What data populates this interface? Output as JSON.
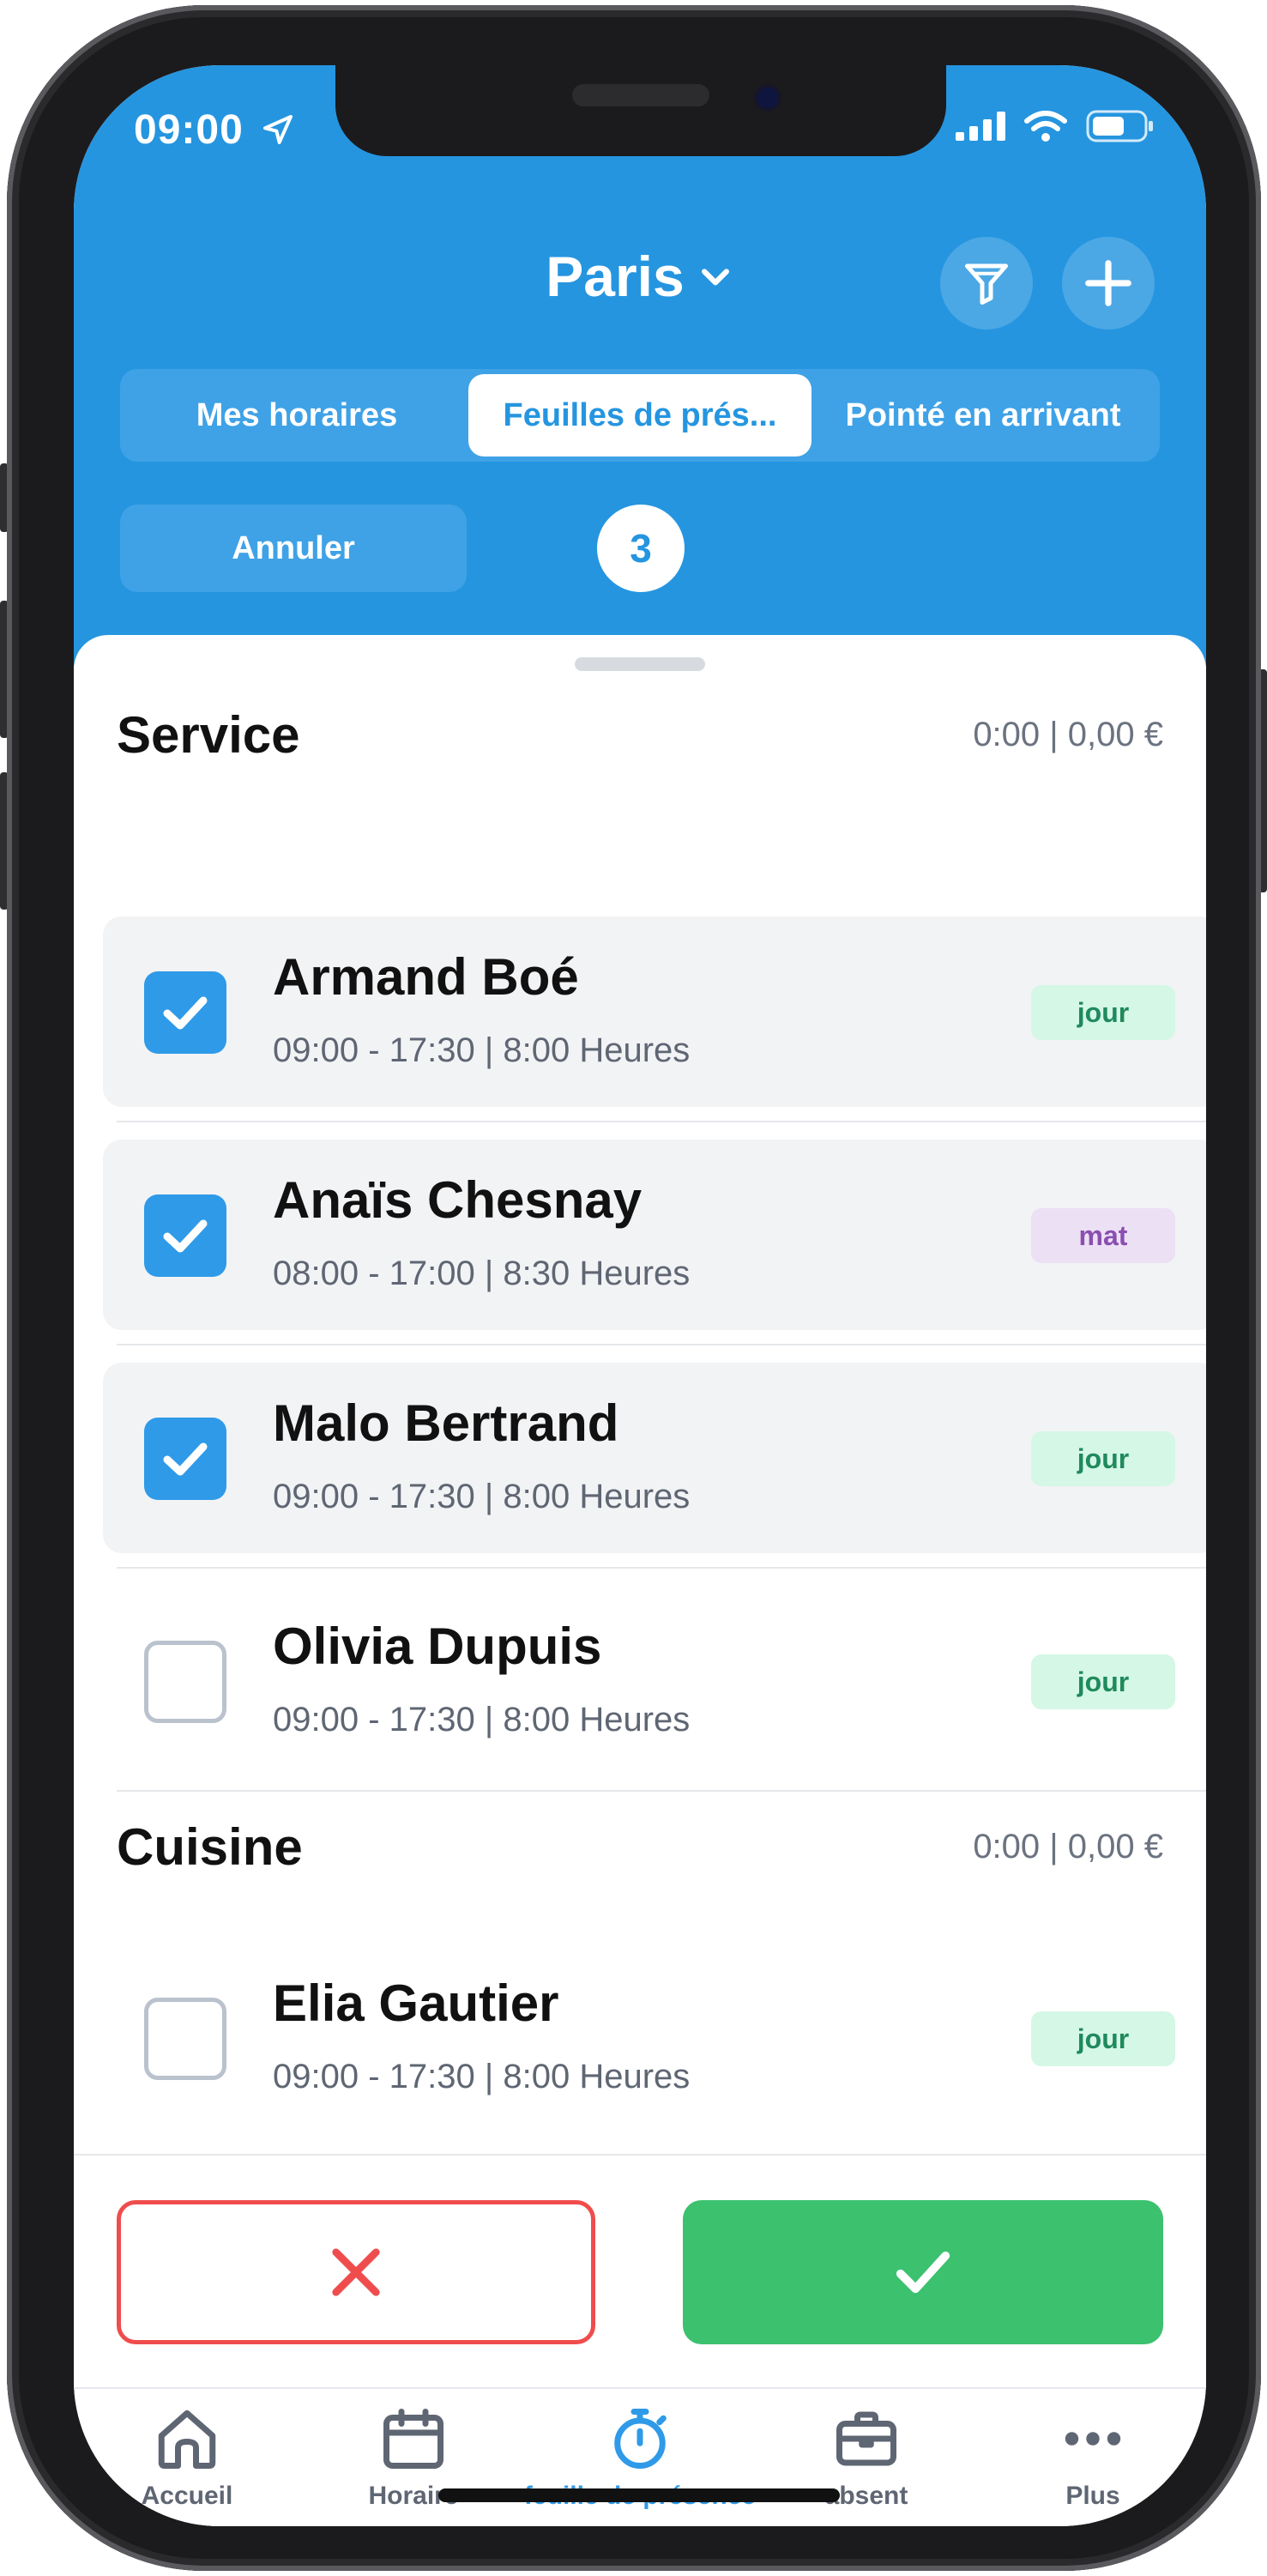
{
  "status_bar": {
    "time": "09:00"
  },
  "header": {
    "location": "Paris",
    "tabs": [
      {
        "label": "Mes horaires",
        "active": false
      },
      {
        "label": "Feuilles de prés...",
        "active": true
      },
      {
        "label": "Pointé en arrivant",
        "active": false
      }
    ],
    "cancel_label": "Annuler",
    "selected_count": "3"
  },
  "sections": [
    {
      "title": "Service",
      "summary": "0:00 | 0,00 €",
      "rows": [
        {
          "name": "Armand Boé",
          "hours": "09:00 - 17:30 | 8:00 Heures",
          "tag": "jour",
          "checked": true
        },
        {
          "name": "Anaïs Chesnay",
          "hours": "08:00 - 17:00 | 8:30 Heures",
          "tag": "mat",
          "checked": true
        },
        {
          "name": "Malo Bertrand",
          "hours": "09:00 - 17:30 | 8:00 Heures",
          "tag": "jour",
          "checked": true
        },
        {
          "name": "Olivia Dupuis",
          "hours": "09:00 - 17:30 | 8:00 Heures",
          "tag": "jour",
          "checked": false
        }
      ]
    },
    {
      "title": "Cuisine",
      "summary": "0:00 | 0,00 €",
      "rows": [
        {
          "name": "Elia Gautier",
          "hours": "09:00 - 17:30 | 8:00 Heures",
          "tag": "jour",
          "checked": false
        }
      ]
    }
  ],
  "bottom_nav": [
    {
      "label": "Accueil",
      "icon": "home-icon",
      "active": false
    },
    {
      "label": "Horaire",
      "icon": "calendar-icon",
      "active": false
    },
    {
      "label": "feuille de présence",
      "icon": "stopwatch-icon",
      "active": true
    },
    {
      "label": "absent",
      "icon": "briefcase-icon",
      "active": false
    },
    {
      "label": "Plus",
      "icon": "more-icon",
      "active": false
    }
  ],
  "colors": {
    "primary": "#2595e0",
    "approve": "#3cc16f",
    "reject": "#ef4d4d"
  }
}
